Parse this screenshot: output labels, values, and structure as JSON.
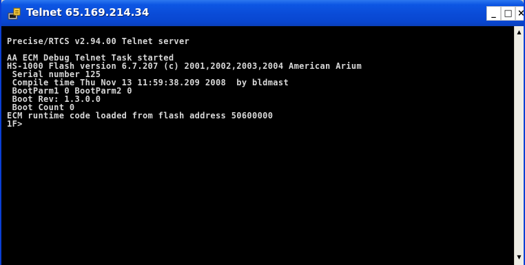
{
  "window": {
    "title": "Telnet 65.169.214.34",
    "icon": "telnet-terminal-icon",
    "controls": {
      "minimize_glyph": "_",
      "maximize_glyph": "□",
      "close_glyph": "×"
    }
  },
  "console": {
    "lines": [
      "Precise/RTCS v2.94.00 Telnet server",
      "",
      "AA ECM Debug Telnet Task started",
      "HS-1000 Flash version 6.7.207 (c) 2001,2002,2003,2004 American Arium",
      " Serial number 125",
      " Compile time Thu Nov 13 11:59:38.209 2008  by bldmast",
      " BootParm1 0 BootParm2 0",
      " Boot Rev: 1.3.0.0",
      " Boot Count 0",
      "ECM runtime code loaded from flash address 50600000",
      "1F>"
    ]
  },
  "scrollbar": {
    "up_glyph": "▲",
    "down_glyph": "▼"
  },
  "colors": {
    "titlebar": "#0a4bd7",
    "console_bg": "#000000",
    "console_text": "#d8d8d8"
  }
}
